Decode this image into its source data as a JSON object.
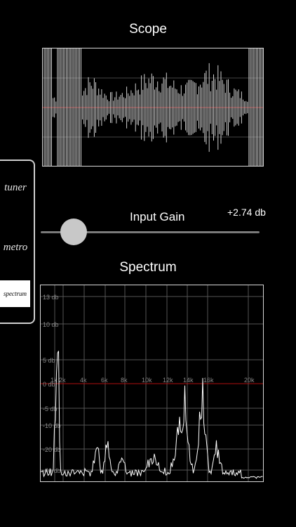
{
  "scope": {
    "title": "Scope"
  },
  "tabs": [
    {
      "label": "tuner"
    },
    {
      "label": "metro"
    },
    {
      "label": "spectrum",
      "selected": true
    }
  ],
  "gain": {
    "label": "Input Gain",
    "value_text": "+2.74 db",
    "level": 0.14
  },
  "spectrum": {
    "title": "Spectrum",
    "db_labels": [
      "13 db",
      "10 db",
      "5 db",
      "0 db",
      "-5 db",
      "-10 db",
      "-20 db",
      "-40 db"
    ],
    "freq_labels": [
      "1k",
      "2k",
      "4k",
      "6k",
      "8k",
      "10k",
      "12k",
      "14k",
      "16k",
      "20k"
    ]
  },
  "colors": {
    "background": "#000000",
    "trace": "#ffffff",
    "reference_line": "#b01010",
    "grid": "#555555"
  }
}
